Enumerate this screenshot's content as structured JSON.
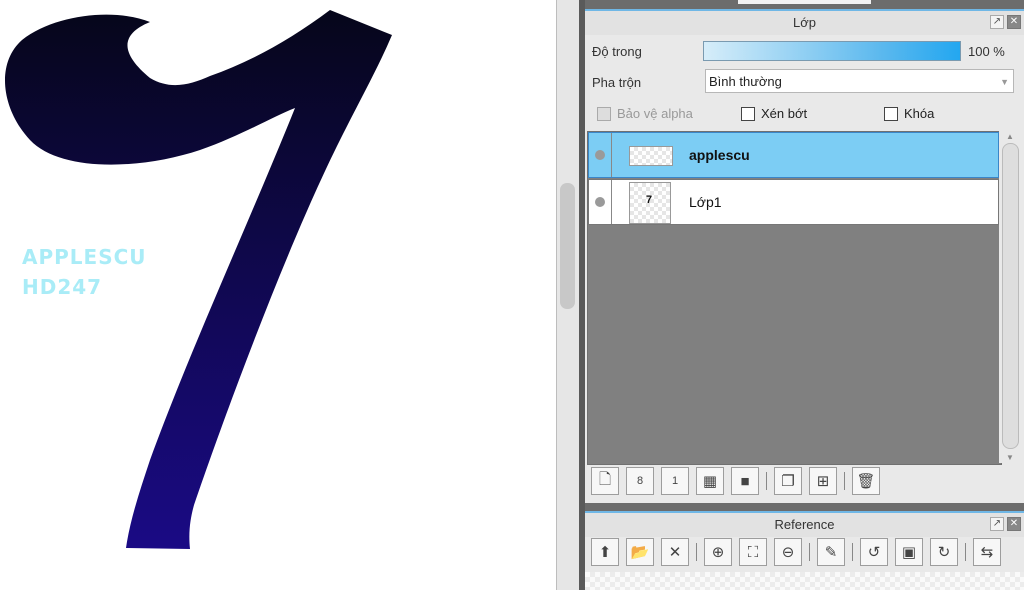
{
  "canvas": {
    "watermark_line1": "APPLESCU",
    "watermark_line2": "HD247",
    "watermark_color": "#a9ecf7",
    "glyph_gradient_top": "#06061a",
    "glyph_gradient_bottom": "#1a0a85"
  },
  "layer_panel": {
    "title": "Lớp",
    "opacity_label": "Độ trong",
    "opacity_value": "100 %",
    "opacity_fraction": 1.0,
    "blend_label": "Pha trộn",
    "blend_value": "Bình thường",
    "protect_alpha_label": "Bảo vệ alpha",
    "clip_label": "Xén bớt",
    "lock_label": "Khóa",
    "layers": [
      {
        "name": "applescu",
        "selected": true,
        "thumb": "wm-thumb"
      },
      {
        "name": "Lớp1",
        "selected": false,
        "thumb": "glyph-thumb"
      }
    ],
    "thumb_glyph": "7",
    "toolbar_icons": [
      "new-layer-icon",
      "new-8bit-layer-icon",
      "new-1bit-layer-icon",
      "new-halftone-layer-icon",
      "new-folder-icon",
      "duplicate-layer-icon",
      "merge-down-icon",
      "delete-layer-icon"
    ]
  },
  "reference_panel": {
    "title": "Reference",
    "toolbar_icons": [
      "load-reference-icon",
      "open-reference-icon",
      "close-reference-icon",
      "zoom-in-icon",
      "fit-screen-icon",
      "zoom-out-icon",
      "eyedropper-icon",
      "rotate-left-icon",
      "actual-size-icon",
      "rotate-right-icon",
      "flip-horizontal-icon"
    ]
  },
  "colors": {
    "accent": "#6fb7e6",
    "selected_layer": "#7ccdf4"
  }
}
